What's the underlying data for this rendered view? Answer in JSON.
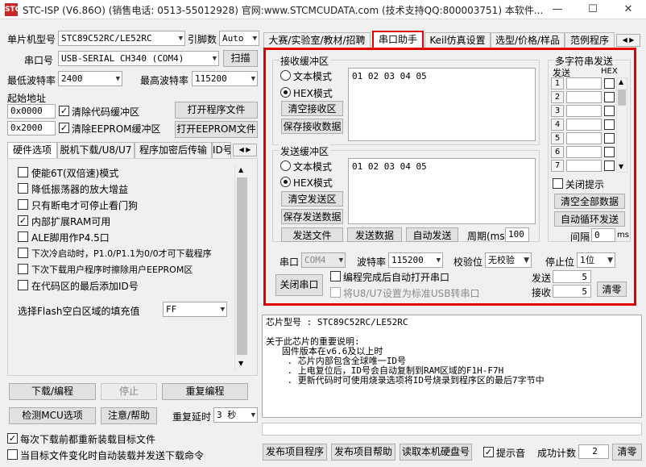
{
  "window": {
    "title": "STC-ISP (V6.86O) (销售电话: 0513-55012928) 官网:www.STCMCUDATA.com  (技术支持QQ:800003751) 本软件...",
    "logo": "STC",
    "minimize": "—",
    "maximize": "☐",
    "close": "✕"
  },
  "left": {
    "mcu_label": "单片机型号",
    "mcu_value": "STC89C52RC/LE52RC",
    "pin_label": "引脚数",
    "pin_value": "Auto",
    "port_label": "串口号",
    "port_value": "USB-SERIAL CH340 (COM4)",
    "scan_button": "扫描",
    "min_baud_label": "最低波特率",
    "min_baud_value": "2400",
    "max_baud_label": "最高波特率",
    "max_baud_value": "115200",
    "start_addr_label": "起始地址",
    "addr1_value": "0x0000",
    "clear_code_label": "清除代码缓冲区",
    "open_prog_button": "打开程序文件",
    "addr2_value": "0x2000",
    "clear_eeprom_label": "清除EEPROM缓冲区",
    "open_eeprom_button": "打开EEPROM文件",
    "tabs": [
      "硬件选项",
      "脱机下载/U8/U7",
      "程序加密后传输",
      "ID号"
    ],
    "options": [
      {
        "label": "使能6T(双倍速)模式",
        "checked": false
      },
      {
        "label": "降低振荡器的放大增益",
        "checked": false
      },
      {
        "label": "只有断电才可停止看门狗",
        "checked": false
      },
      {
        "label": "内部扩展RAM可用",
        "checked": true
      },
      {
        "label": "ALE脚用作P4.5口",
        "checked": false
      },
      {
        "label": "下次冷启动时，P1.0/P1.1为0/0才可下载程序",
        "checked": false
      },
      {
        "label": "下次下载用户程序时擦除用户EEPROM区",
        "checked": false
      },
      {
        "label": "在代码区的最后添加ID号",
        "checked": false
      }
    ],
    "flash_fill_label": "选择Flash空白区域的填充值",
    "flash_fill_value": "FF",
    "download_button": "下载/编程",
    "stop_button": "停止",
    "reprogram_button": "重复编程",
    "check_mcu_button": "检测MCU选项",
    "help_button": "注意/帮助",
    "repeat_delay_label": "重复延时",
    "repeat_delay_value": "3 秒",
    "reload_before_label": "每次下载前都重新装载目标文件",
    "auto_reload_label": "当目标文件变化时自动装载并发送下载命令"
  },
  "right": {
    "tabs": [
      "大赛/实验室/教材/招聘",
      "串口助手",
      "Keil仿真设置",
      "选型/价格/样品",
      "范例程序"
    ],
    "recv": {
      "title": "接收缓冲区",
      "text_mode": "文本模式",
      "hex_mode": "HEX模式",
      "clear_button": "清空接收区",
      "save_button": "保存接收数据",
      "content": "01 02 03 04 05"
    },
    "send": {
      "title": "发送缓冲区",
      "text_mode": "文本模式",
      "hex_mode": "HEX模式",
      "clear_button": "清空发送区",
      "save_button": "保存发送数据",
      "content": "01 02 03 04 05",
      "send_file_button": "发送文件",
      "send_data_button": "发送数据",
      "auto_send_button": "自动发送",
      "period_label": "周期(ms)",
      "period_value": "100"
    },
    "multi": {
      "title": "多字符串发送",
      "send_col": "发送",
      "hex_col": "HEX",
      "rows": [
        "1",
        "2",
        "3",
        "4",
        "5",
        "6",
        "7"
      ],
      "close_hint_label": "关闭提示",
      "clear_all_button": "清空全部数据",
      "auto_loop_button": "自动循环发送",
      "interval_label": "间隔",
      "interval_value": "0",
      "interval_unit": "ms"
    },
    "serial": {
      "port_label": "串口",
      "port_value": "COM4",
      "baud_label": "波特率",
      "baud_value": "115200",
      "parity_label": "校验位",
      "parity_value": "无校验",
      "stop_label": "停止位",
      "stop_value": "1位",
      "close_port_button": "关闭串口",
      "auto_open_label": "编程完成后自动打开串口",
      "usb_label": "将U8/U7设置为标准USB转串口",
      "sent_label": "发送",
      "sent_value": "5",
      "recv_label": "接收",
      "recv_value": "5",
      "clear_button": "清零"
    },
    "info": {
      "text": "芯片型号 : STC89C52RC/LE52RC\n\n关于此芯片的重要说明:\n   固件版本在v6.6及以上时\n    . 芯片内部包含全球唯一ID号\n    . 上电复位后，ID号会自动复制到RAM区域的F1H-F7H\n    . 更新代码时可使用烧录选项将ID号烧录到程序区的最后7字节中"
    },
    "bottom": {
      "publish_prog_button": "发布项目程序",
      "publish_help_button": "发布项目帮助",
      "read_serial_button": "读取本机硬盘号",
      "beep_label": "提示音",
      "success_label": "成功计数",
      "success_value": "2",
      "clear_button": "清零"
    }
  },
  "colors": {
    "highlight": "#e00000",
    "background": "#f0f0f0"
  }
}
